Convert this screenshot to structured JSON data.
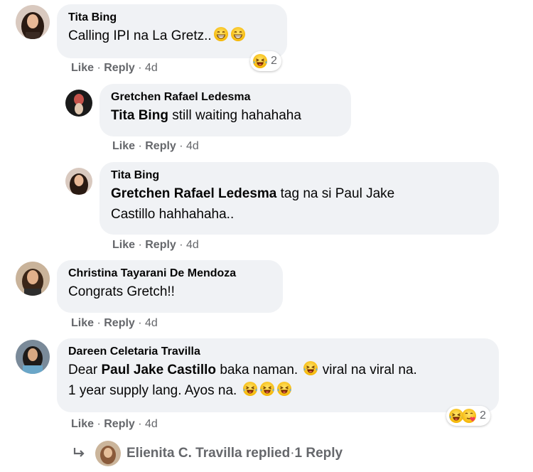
{
  "comments": [
    {
      "author": "Tita Bing",
      "text": "Calling IPI na La Gretz..",
      "actions": {
        "like": "Like",
        "reply": "Reply",
        "time": "4d"
      },
      "reaction_count": "2"
    },
    {
      "author": "Gretchen Rafael Ledesma",
      "mention": "Tita Bing",
      "text": "still waiting hahahaha",
      "actions": {
        "like": "Like",
        "reply": "Reply",
        "time": "4d"
      }
    },
    {
      "author": "Tita Bing",
      "mention": "Gretchen Rafael Ledesma",
      "text_line1": "tag na si Paul Jake",
      "text_line2": "Castillo hahhahaha..",
      "actions": {
        "like": "Like",
        "reply": "Reply",
        "time": "4d"
      }
    },
    {
      "author": "Christina Tayarani De Mendoza",
      "text": "Congrats Gretch!!",
      "actions": {
        "like": "Like",
        "reply": "Reply",
        "time": "4d"
      }
    },
    {
      "author": "Dareen Celetaria Travilla",
      "prefix": "Dear",
      "mention": "Paul Jake Castillo",
      "text_line1": "baka naman.",
      "text_line1b": "viral na viral na.",
      "text_line2": "1 year supply lang. Ayos na.",
      "actions": {
        "like": "Like",
        "reply": "Reply",
        "time": "4d"
      },
      "reaction_count": "2"
    }
  ],
  "replies_link": {
    "name": "Elienita C. Travilla replied",
    "count": "1 Reply"
  },
  "separators": {
    "dot": " · "
  },
  "colors": {
    "bubble": "#f0f2f5",
    "meta": "#65676b",
    "text": "#050505"
  },
  "icons": [
    "grin-emoji",
    "laughing-tears-emoji",
    "haha-reaction",
    "love-reaction",
    "reply-arrow-icon"
  ]
}
